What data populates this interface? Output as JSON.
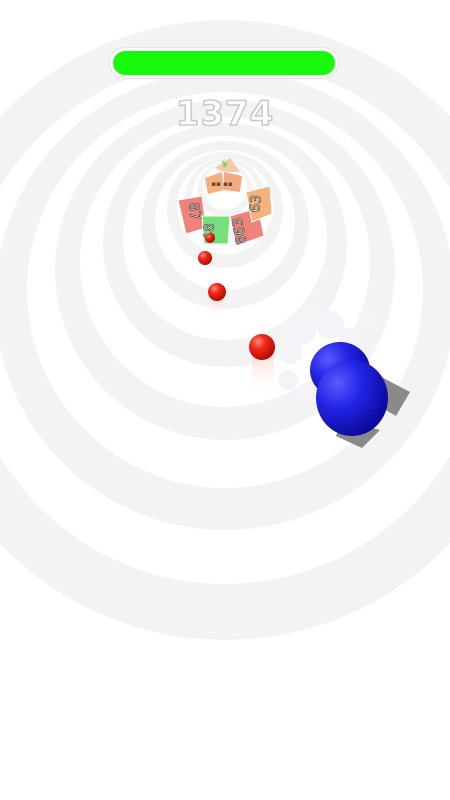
{
  "hud": {
    "score": "1374",
    "progress": 1.0
  },
  "targets": {
    "ring_values": [
      "87",
      "48",
      "863",
      "63"
    ]
  },
  "colors": {
    "progress_fill": "#18f80a",
    "ball": "#e8140c",
    "player": "#1f1fe0",
    "panel_red": "#f07e78",
    "panel_orange": "#f5b27a",
    "panel_green": "#74e07a",
    "tunnel_ring": "#f2f2f2"
  }
}
